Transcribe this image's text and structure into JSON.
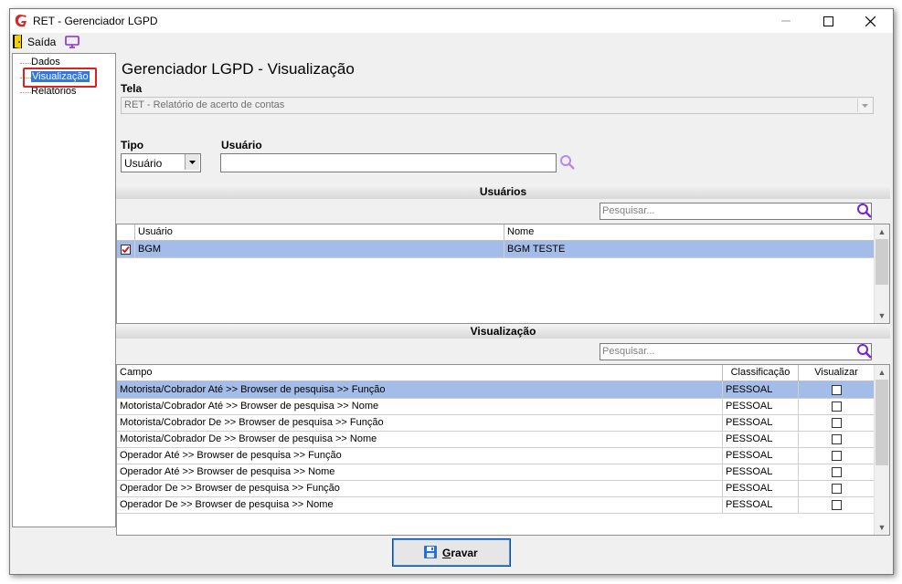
{
  "window": {
    "title": "RET - Gerenciador LGPD",
    "minimize_label": "–",
    "maximize_label": "☐",
    "close_label": "✕"
  },
  "toolbar": {
    "exit_label": "Saída"
  },
  "tree": {
    "items": [
      {
        "label": "Dados"
      },
      {
        "label": "Visualização",
        "selected": true
      },
      {
        "label": "Relatórios"
      }
    ]
  },
  "page": {
    "title": "Gerenciador LGPD - Visualização"
  },
  "form": {
    "tela_label": "Tela",
    "tela_value": "RET - Relatório de acerto de contas",
    "tipo_label": "Tipo",
    "tipo_value": "Usuário",
    "usuario_label": "Usuário",
    "usuario_value": ""
  },
  "usuarios": {
    "section_title": "Usuários",
    "search_placeholder": "Pesquisar...",
    "columns": [
      "Usuário",
      "Nome"
    ],
    "rows": [
      {
        "checked": true,
        "usuario": "BGM",
        "nome": "BGM TESTE"
      }
    ]
  },
  "visualizacao": {
    "section_title": "Visualização",
    "search_placeholder": "Pesquisar...",
    "columns": [
      "Campo",
      "Classificação",
      "Visualizar"
    ],
    "rows": [
      {
        "campo": "Motorista/Cobrador Até >> Browser de pesquisa >> Função",
        "classificacao": "PESSOAL",
        "visualizar": false
      },
      {
        "campo": "Motorista/Cobrador Até >> Browser de pesquisa >> Nome",
        "classificacao": "PESSOAL",
        "visualizar": false
      },
      {
        "campo": "Motorista/Cobrador De >> Browser de pesquisa >> Função",
        "classificacao": "PESSOAL",
        "visualizar": false
      },
      {
        "campo": "Motorista/Cobrador De >> Browser de pesquisa >> Nome",
        "classificacao": "PESSOAL",
        "visualizar": false
      },
      {
        "campo": "Operador Até >> Browser de pesquisa >> Função",
        "classificacao": "PESSOAL",
        "visualizar": false
      },
      {
        "campo": "Operador Até >> Browser de pesquisa >> Nome",
        "classificacao": "PESSOAL",
        "visualizar": false
      },
      {
        "campo": "Operador De >> Browser de pesquisa >> Função",
        "classificacao": "PESSOAL",
        "visualizar": false
      },
      {
        "campo": "Operador De >> Browser de pesquisa >> Nome",
        "classificacao": "PESSOAL",
        "visualizar": false
      }
    ]
  },
  "buttons": {
    "save_label_first": "G",
    "save_label_rest": "ravar"
  },
  "colors": {
    "selection": "#a4bde8",
    "tree_selection": "#3278d7",
    "accent_purple": "#8a2be2",
    "highlight_box": "#e02020"
  },
  "icons": [
    "app-logo-icon",
    "exit-icon",
    "monitor-icon",
    "search-icon",
    "save-disk-icon",
    "checkbox-icon"
  ]
}
